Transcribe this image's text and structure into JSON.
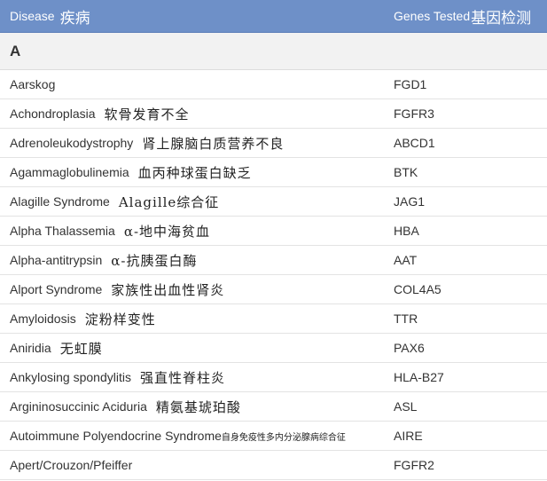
{
  "header": {
    "disease_label": "Disease",
    "disease_cn": "疾病",
    "genes_label": "Genes Tested",
    "genes_cn": "基因检测"
  },
  "section": {
    "letter": "A"
  },
  "rows": [
    {
      "name": "Aarskog",
      "cn": "",
      "gene": "FGD1"
    },
    {
      "name": "Achondroplasia",
      "cn": "软骨发育不全",
      "gene": "FGFR3"
    },
    {
      "name": "Adrenoleukodystrophy",
      "cn": "肾上腺脑白质营养不良",
      "gene": "ABCD1"
    },
    {
      "name": "Agammaglobulinemia",
      "cn": "血丙种球蛋白缺乏",
      "gene": "BTK"
    },
    {
      "name": "Alagille Syndrome",
      "cn": "Alagille综合征",
      "gene": "JAG1"
    },
    {
      "name": "Alpha Thalassemia",
      "cn": "α-地中海贫血",
      "gene": "HBA"
    },
    {
      "name": "Alpha-antitrypsin",
      "cn": "α-抗胰蛋白酶",
      "gene": "AAT"
    },
    {
      "name": "Alport Syndrome",
      "cn": "家族性出血性肾炎",
      "gene": "COL4A5"
    },
    {
      "name": "Amyloidosis",
      "cn": "淀粉样变性",
      "gene": "TTR"
    },
    {
      "name": "Aniridia",
      "cn": "无虹膜",
      "gene": "PAX6"
    },
    {
      "name": "Ankylosing spondylitis",
      "cn": "强直性脊柱炎",
      "gene": "HLA-B27"
    },
    {
      "name": "Argininosuccinic Aciduria",
      "cn": "精氨基琥珀酸",
      "gene": "ASL"
    },
    {
      "name": "Autoimmune Polyendocrine Syndrome",
      "cn": "自身免疫性多内分泌腺病综合征",
      "gene": "AIRE"
    },
    {
      "name": "Apert/Crouzon/Pfeiffer",
      "cn": "",
      "gene": "FGFR2"
    }
  ]
}
